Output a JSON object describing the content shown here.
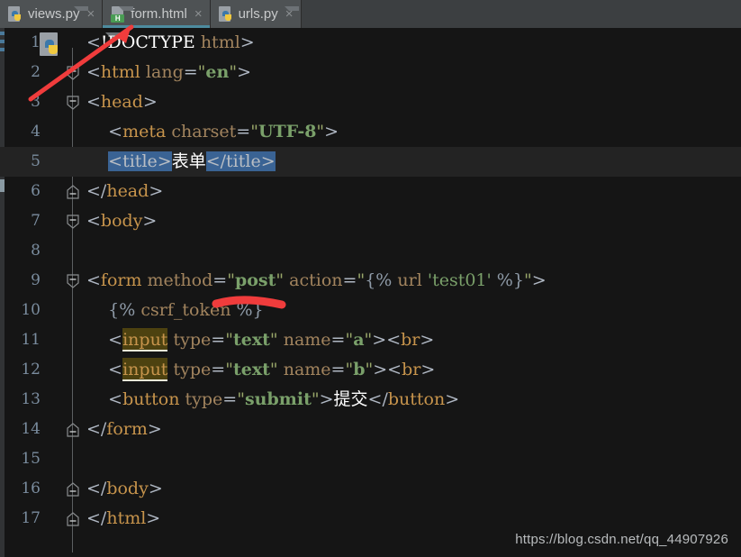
{
  "window": {
    "app": "PyCharm Editor",
    "accent_color": "#4d8b9e",
    "background": "#151515",
    "tabbar_background": "#3c3f41"
  },
  "tabs": [
    {
      "label": "views.py",
      "icon": "python-file-icon",
      "active": false,
      "close": "×"
    },
    {
      "label": "form.html",
      "icon": "html-file-icon",
      "active": true,
      "close": "×"
    },
    {
      "label": "urls.py",
      "icon": "python-file-icon",
      "active": false,
      "close": "×"
    }
  ],
  "editor": {
    "language": "html",
    "gutter_icon": "python-file-icon",
    "current_line": 5,
    "selection_color": "#3a6394",
    "occurrence_highlight_color": "#4d4210",
    "lines": [
      {
        "n": "1",
        "fold": "none"
      },
      {
        "n": "2",
        "fold": "open"
      },
      {
        "n": "3",
        "fold": "open"
      },
      {
        "n": "4",
        "fold": "none"
      },
      {
        "n": "5",
        "fold": "none"
      },
      {
        "n": "6",
        "fold": "close"
      },
      {
        "n": "7",
        "fold": "open"
      },
      {
        "n": "8",
        "fold": "none"
      },
      {
        "n": "9",
        "fold": "open"
      },
      {
        "n": "10",
        "fold": "none"
      },
      {
        "n": "11",
        "fold": "none"
      },
      {
        "n": "12",
        "fold": "none"
      },
      {
        "n": "13",
        "fold": "none"
      },
      {
        "n": "14",
        "fold": "close"
      },
      {
        "n": "15",
        "fold": "none"
      },
      {
        "n": "16",
        "fold": "close"
      },
      {
        "n": "17",
        "fold": "close"
      }
    ],
    "code_text": [
      "<!DOCTYPE html>",
      "<html lang=\"en\">",
      "<head>",
      "    <meta charset=\"UTF-8\">",
      "    <title>表单</title>",
      "</head>",
      "<body>",
      "",
      "<form method=\"post\" action=\"{% url 'test01' %}\">",
      "    {% csrf_token %}",
      "    <input type=\"text\" name=\"a\"><br>",
      "    <input type=\"text\" name=\"b\"><br>",
      "    <button type=\"submit\">提交</button>",
      "</form>",
      "",
      "</body>",
      "</html>"
    ]
  },
  "annotations": {
    "arrow_color": "#f03c3c",
    "arrow_target": "form.html tab",
    "underline_target": "csrf_token"
  },
  "watermark": {
    "text": "https://blog.csdn.net/qq_44907926"
  }
}
